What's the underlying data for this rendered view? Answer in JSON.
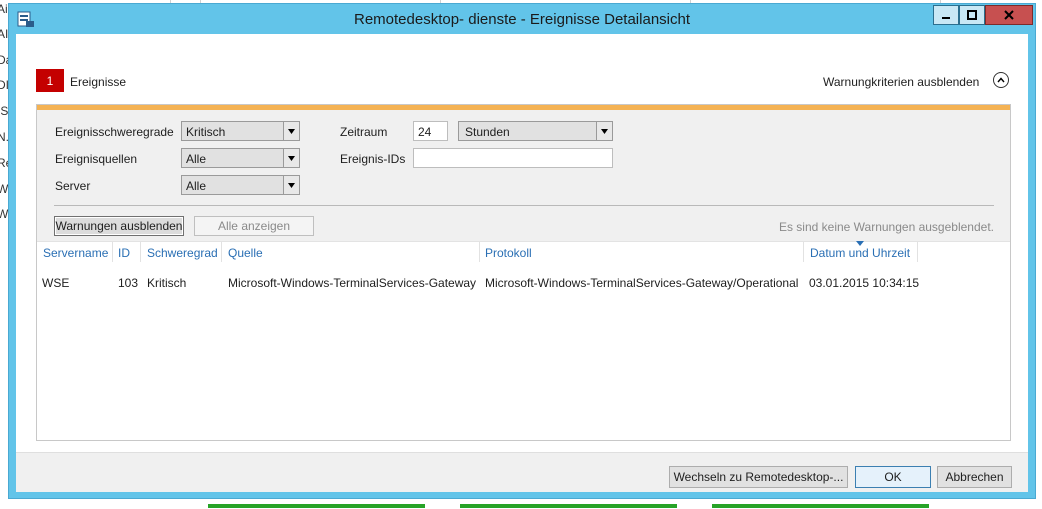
{
  "background": {
    "left_fragments": [
      "Ai",
      "AI",
      "Da",
      "DI",
      "IS",
      "N.",
      "Re",
      "W",
      "W"
    ]
  },
  "window": {
    "title": "Remotedesktop- dienste - Ereignisse Detailansicht"
  },
  "header": {
    "badge_count": "1",
    "badge_label": "Ereignisse",
    "toggle_label": "Warnungkriterien ausblenden"
  },
  "criteria": {
    "severity_label": "Ereignisschweregrade",
    "severity_value": "Kritisch",
    "sources_label": "Ereignisquellen",
    "sources_value": "Alle",
    "server_label": "Server",
    "server_value": "Alle",
    "period_label": "Zeitraum",
    "period_value": "24",
    "period_unit": "Stunden",
    "event_ids_label": "Ereignis-IDs",
    "event_ids_value": ""
  },
  "actions": {
    "hide_warnings": "Warnungen ausblenden",
    "show_all": "Alle anzeigen",
    "hint": "Es sind keine Warnungen ausgeblendet."
  },
  "table": {
    "columns": [
      "Servername",
      "ID",
      "Schweregrad",
      "Quelle",
      "Protokoll",
      "Datum und Uhrzeit"
    ],
    "rows": [
      [
        "WSE",
        "103",
        "Kritisch",
        "Microsoft-Windows-TerminalServices-Gateway",
        "Microsoft-Windows-TerminalServices-Gateway/Operational",
        "03.01.2015 10:34:15"
      ]
    ]
  },
  "footer": {
    "switch_label": "Wechseln zu Remotedesktop-...",
    "ok_label": "OK",
    "cancel_label": "Abbrechen"
  },
  "colors": {
    "title_bar": "#62c4e9",
    "badge": "#c40000",
    "panel_accent": "#f4b253",
    "column_header": "#2a6fb4",
    "close_button": "#c75050"
  },
  "icons": {
    "app": "server-manager-icon",
    "collapse": "chevron-up-circle-icon",
    "dropdown": "dropdown-arrow-icon",
    "sort": "sort-descending-icon"
  }
}
